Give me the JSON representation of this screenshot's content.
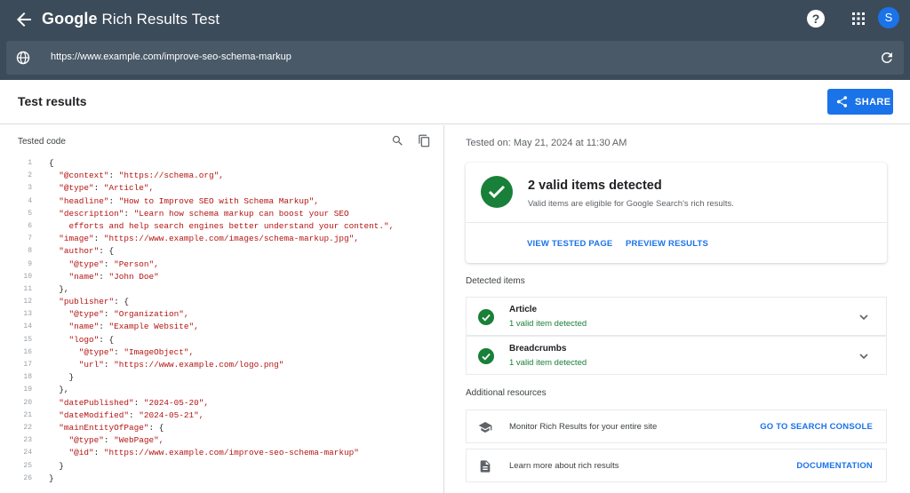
{
  "topbar": {
    "brand_word": "Google",
    "product": "Rich Results Test",
    "help_glyph": "?",
    "avatar_initial": "S"
  },
  "urlbar": {
    "url": "https://www.example.com/improve-seo-schema-markup"
  },
  "header": {
    "title": "Test results",
    "share_label": "SHARE"
  },
  "code_panel": {
    "label": "Tested code",
    "lines": [
      {
        "n": "1",
        "t": "{"
      },
      {
        "n": "2",
        "k": "  \"@context\"",
        "s": "\"https://schema.org\","
      },
      {
        "n": "3",
        "k": "  \"@type\"",
        "s": "\"Article\","
      },
      {
        "n": "4",
        "k": "  \"headline\"",
        "s": "\"How to Improve SEO with Schema Markup\","
      },
      {
        "n": "5",
        "k": "  \"description\"",
        "s": "\"Learn how schema markup can boost your SEO"
      },
      {
        "n": "6",
        "t": "    ",
        "s2": "efforts and help search engines better understand your content.\","
      },
      {
        "n": "7",
        "k": "  \"image\"",
        "s": "\"https://www.example.com/images/schema-markup.jpg\","
      },
      {
        "n": "8",
        "k": "  \"author\"",
        "t2": "{"
      },
      {
        "n": "9",
        "k": "    \"@type\"",
        "s": "\"Person\","
      },
      {
        "n": "10",
        "k": "    \"name\"",
        "s": "\"John Doe\""
      },
      {
        "n": "11",
        "t": "  },"
      },
      {
        "n": "12",
        "k": "  \"publisher\"",
        "t2": "{"
      },
      {
        "n": "13",
        "k": "    \"@type\"",
        "s": "\"Organization\","
      },
      {
        "n": "14",
        "k": "    \"name\"",
        "s": "\"Example Website\","
      },
      {
        "n": "15",
        "k": "    \"logo\"",
        "t2": "{"
      },
      {
        "n": "16",
        "k": "      \"@type\"",
        "s": "\"ImageObject\","
      },
      {
        "n": "17",
        "k": "      \"url\"",
        "s": "\"https://www.example.com/logo.png\""
      },
      {
        "n": "18",
        "t": "    }"
      },
      {
        "n": "19",
        "t": "  },"
      },
      {
        "n": "20",
        "k": "  \"datePublished\"",
        "s": "\"2024-05-20\","
      },
      {
        "n": "21",
        "k": "  \"dateModified\"",
        "s": "\"2024-05-21\","
      },
      {
        "n": "22",
        "k": "  \"mainEntityOfPage\"",
        "t2": "{"
      },
      {
        "n": "23",
        "k": "    \"@type\"",
        "s": "\"WebPage\","
      },
      {
        "n": "24",
        "k": "    \"@id\"",
        "s": "\"https://www.example.com/improve-seo-schema-markup\""
      },
      {
        "n": "25",
        "t": "  }"
      },
      {
        "n": "26",
        "t": "}"
      }
    ]
  },
  "results": {
    "tested_on": "Tested on: May 21, 2024 at 11:30 AM",
    "summary_title": "2 valid items detected",
    "summary_sub": "Valid items are eligible for Google Search's rich results.",
    "view_tested_page": "VIEW TESTED PAGE",
    "preview_results": "PREVIEW RESULTS",
    "detected_label": "Detected items",
    "items": [
      {
        "name": "Article",
        "status": "1 valid item detected"
      },
      {
        "name": "Breadcrumbs",
        "status": "1 valid item detected"
      }
    ],
    "resources_label": "Additional resources",
    "resources": [
      {
        "text": "Monitor Rich Results for your entire site",
        "link": "GO TO SEARCH CONSOLE",
        "icon": "graduation-cap-icon"
      },
      {
        "text": "Learn more about rich results",
        "link": "DOCUMENTATION",
        "icon": "document-icon"
      }
    ]
  },
  "colors": {
    "topbar": "#3c4b5a",
    "accent": "#1a73e8",
    "success": "#188038",
    "code_string": "#b31412"
  }
}
